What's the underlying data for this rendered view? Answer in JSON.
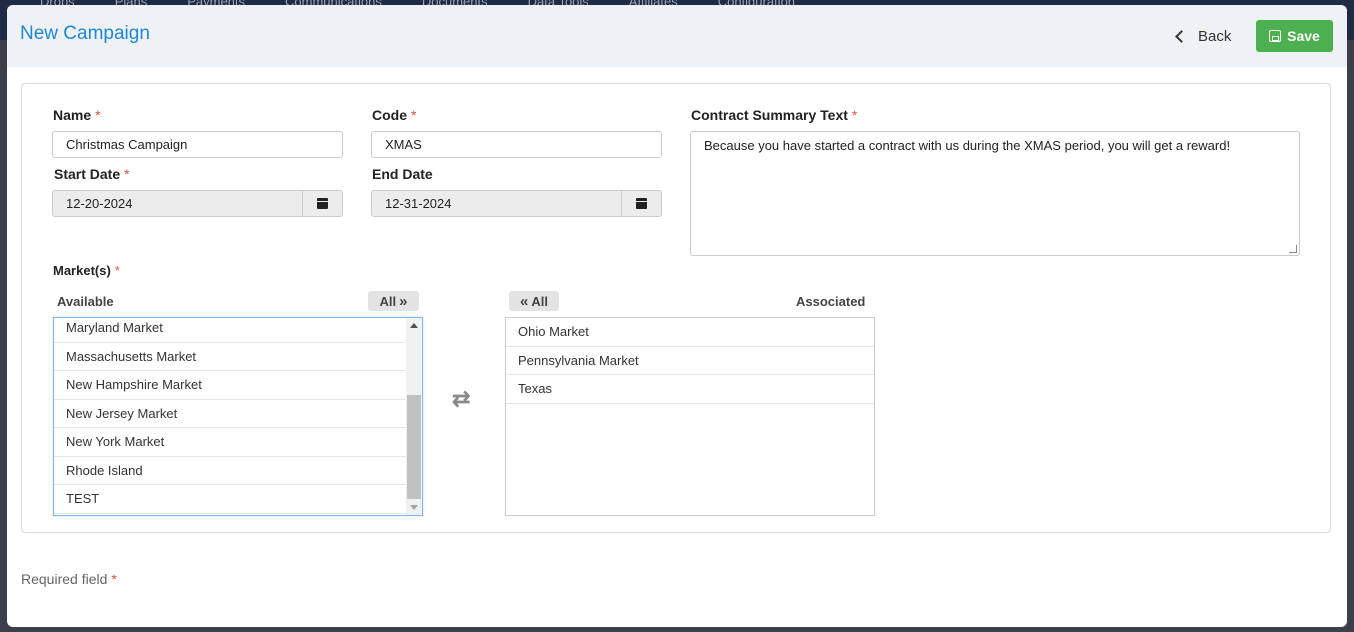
{
  "background_nav": {
    "items": [
      "Drops",
      "Plans",
      "Payments",
      "Communications",
      "Documents",
      "Data Tools",
      "Affiliates",
      "Configuration"
    ]
  },
  "header": {
    "title": "New Campaign",
    "back_label": "Back",
    "save_label": "Save"
  },
  "form": {
    "name": {
      "label": "Name",
      "value": "Christmas Campaign"
    },
    "code": {
      "label": "Code",
      "value": "XMAS"
    },
    "summary": {
      "label": "Contract Summary Text",
      "value": "Because you have started a contract with us during the XMAS period, you will get a reward!"
    },
    "start_date": {
      "label": "Start Date",
      "value": "12-20-2024"
    },
    "end_date": {
      "label": "End Date",
      "value": "12-31-2024"
    },
    "markets": {
      "label": "Market(s)",
      "available_label": "Available",
      "associated_label": "Associated",
      "add_all_label": "All",
      "remove_all_label": "All",
      "available": [
        "Maryland Market",
        "Massachusetts Market",
        "New Hampshire Market",
        "New Jersey Market",
        "New York Market",
        "Rhode Island",
        "TEST"
      ],
      "associated": [
        "Ohio Market",
        "Pennsylvania Market",
        "Texas"
      ]
    }
  },
  "required_marker": "*",
  "footer": {
    "required_label": "Required field"
  }
}
